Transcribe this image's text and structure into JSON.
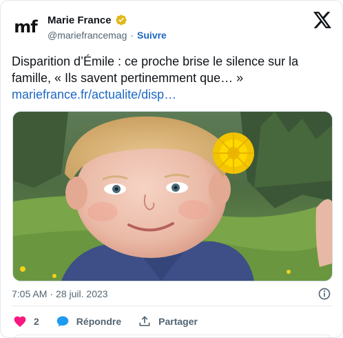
{
  "author": {
    "avatar_text": "mf",
    "display_name": "Marie France",
    "handle": "@mariefrancemag",
    "separator": "·",
    "follow_label": "Suivre"
  },
  "tweet": {
    "text": "Disparition d’Émile : ce proche brise le silence sur la famille, « Ils savent pertinemment que… »",
    "link": "mariefrance.fr/actualite/disp…"
  },
  "meta": {
    "time": "7:05 AM",
    "separator": "·",
    "date": "28 juil. 2023"
  },
  "actions": {
    "like_count": "2",
    "reply_label": "Répondre",
    "share_label": "Partager"
  },
  "colors": {
    "link": "#1d67c4",
    "like": "#f91880",
    "reply": "#1d9bf0",
    "verified": "#e2b719",
    "secondary_text": "#536471"
  },
  "icons": {
    "verified": "verified-badge-icon",
    "logo": "x-logo-icon",
    "info": "info-icon",
    "like": "heart-icon",
    "reply": "chat-bubble-icon",
    "share": "share-upload-icon"
  }
}
